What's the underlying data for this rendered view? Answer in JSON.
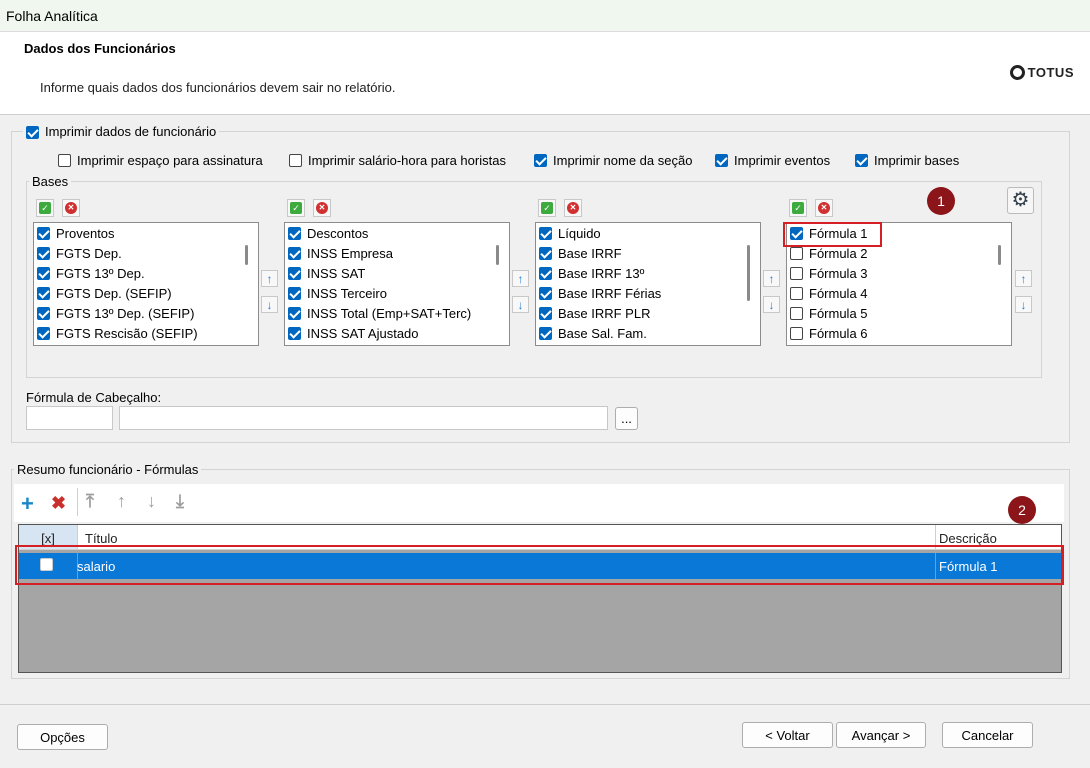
{
  "window": {
    "title": "Folha Analítica"
  },
  "header": {
    "title": "Dados dos Funcionários",
    "subtitle": "Informe quais dados dos funcionários devem sair no relatório.",
    "logo_text": "TOTUS"
  },
  "group_funcionario": {
    "checkbox_label": "Imprimir dados de funcionário",
    "checked": true,
    "options": [
      {
        "label": "Imprimir espaço para assinatura",
        "checked": false
      },
      {
        "label": "Imprimir salário-hora para horistas",
        "checked": false
      },
      {
        "label": "Imprimir nome da seção",
        "checked": true
      },
      {
        "label": "Imprimir eventos",
        "checked": true
      },
      {
        "label": "Imprimir bases",
        "checked": true
      }
    ]
  },
  "bases": {
    "legend": "Bases",
    "lists": [
      {
        "items": [
          {
            "label": "Proventos",
            "checked": true
          },
          {
            "label": "FGTS Dep.",
            "checked": true
          },
          {
            "label": "FGTS 13º Dep.",
            "checked": true
          },
          {
            "label": "FGTS Dep. (SEFIP)",
            "checked": true
          },
          {
            "label": "FGTS 13º Dep. (SEFIP)",
            "checked": true
          },
          {
            "label": "FGTS Rescisão (SEFIP)",
            "checked": true
          }
        ]
      },
      {
        "items": [
          {
            "label": "Descontos",
            "checked": true
          },
          {
            "label": "INSS Empresa",
            "checked": true
          },
          {
            "label": "INSS SAT",
            "checked": true
          },
          {
            "label": "INSS Terceiro",
            "checked": true
          },
          {
            "label": "INSS Total (Emp+SAT+Terc)",
            "checked": true
          },
          {
            "label": "INSS SAT Ajustado",
            "checked": true
          }
        ]
      },
      {
        "items": [
          {
            "label": "Líquido",
            "checked": true
          },
          {
            "label": "Base IRRF",
            "checked": true
          },
          {
            "label": "Base IRRF 13º",
            "checked": true
          },
          {
            "label": "Base IRRF Férias",
            "checked": true
          },
          {
            "label": "Base IRRF PLR",
            "checked": true
          },
          {
            "label": "Base Sal. Fam.",
            "checked": true
          }
        ]
      },
      {
        "items": [
          {
            "label": "Fórmula 1",
            "checked": true
          },
          {
            "label": "Fórmula 2",
            "checked": false
          },
          {
            "label": "Fórmula 3",
            "checked": false
          },
          {
            "label": "Fórmula 4",
            "checked": false
          },
          {
            "label": "Fórmula 5",
            "checked": false
          },
          {
            "label": "Fórmula 6",
            "checked": false
          }
        ]
      }
    ]
  },
  "formula_cabecalho": {
    "label": "Fórmula de Cabeçalho:",
    "code_value": "",
    "desc_value": "",
    "browse_label": "..."
  },
  "markers": {
    "one": "1",
    "two": "2"
  },
  "resumo": {
    "legend": "Resumo funcionário - Fórmulas",
    "columns": {
      "check": "[x]",
      "titulo": "Título",
      "descricao": "Descrição"
    },
    "rows": [
      {
        "checked": false,
        "titulo": "salario",
        "descricao": "Fórmula 1"
      }
    ]
  },
  "icons": {
    "add": "plus-icon",
    "delete": "x-icon",
    "move_top": "arrow-top-icon",
    "move_up": "arrow-up-icon",
    "move_down": "arrow-down-icon",
    "move_bottom": "arrow-bottom-icon",
    "settings": "gear-icon"
  },
  "colors": {
    "accent": "#0067c0",
    "selection": "#0a78d7",
    "marker": "#8b1519",
    "highlight": "#d51f24"
  },
  "footer": {
    "options": "Opções",
    "back": "< Voltar",
    "next": "Avançar >",
    "cancel": "Cancelar"
  }
}
